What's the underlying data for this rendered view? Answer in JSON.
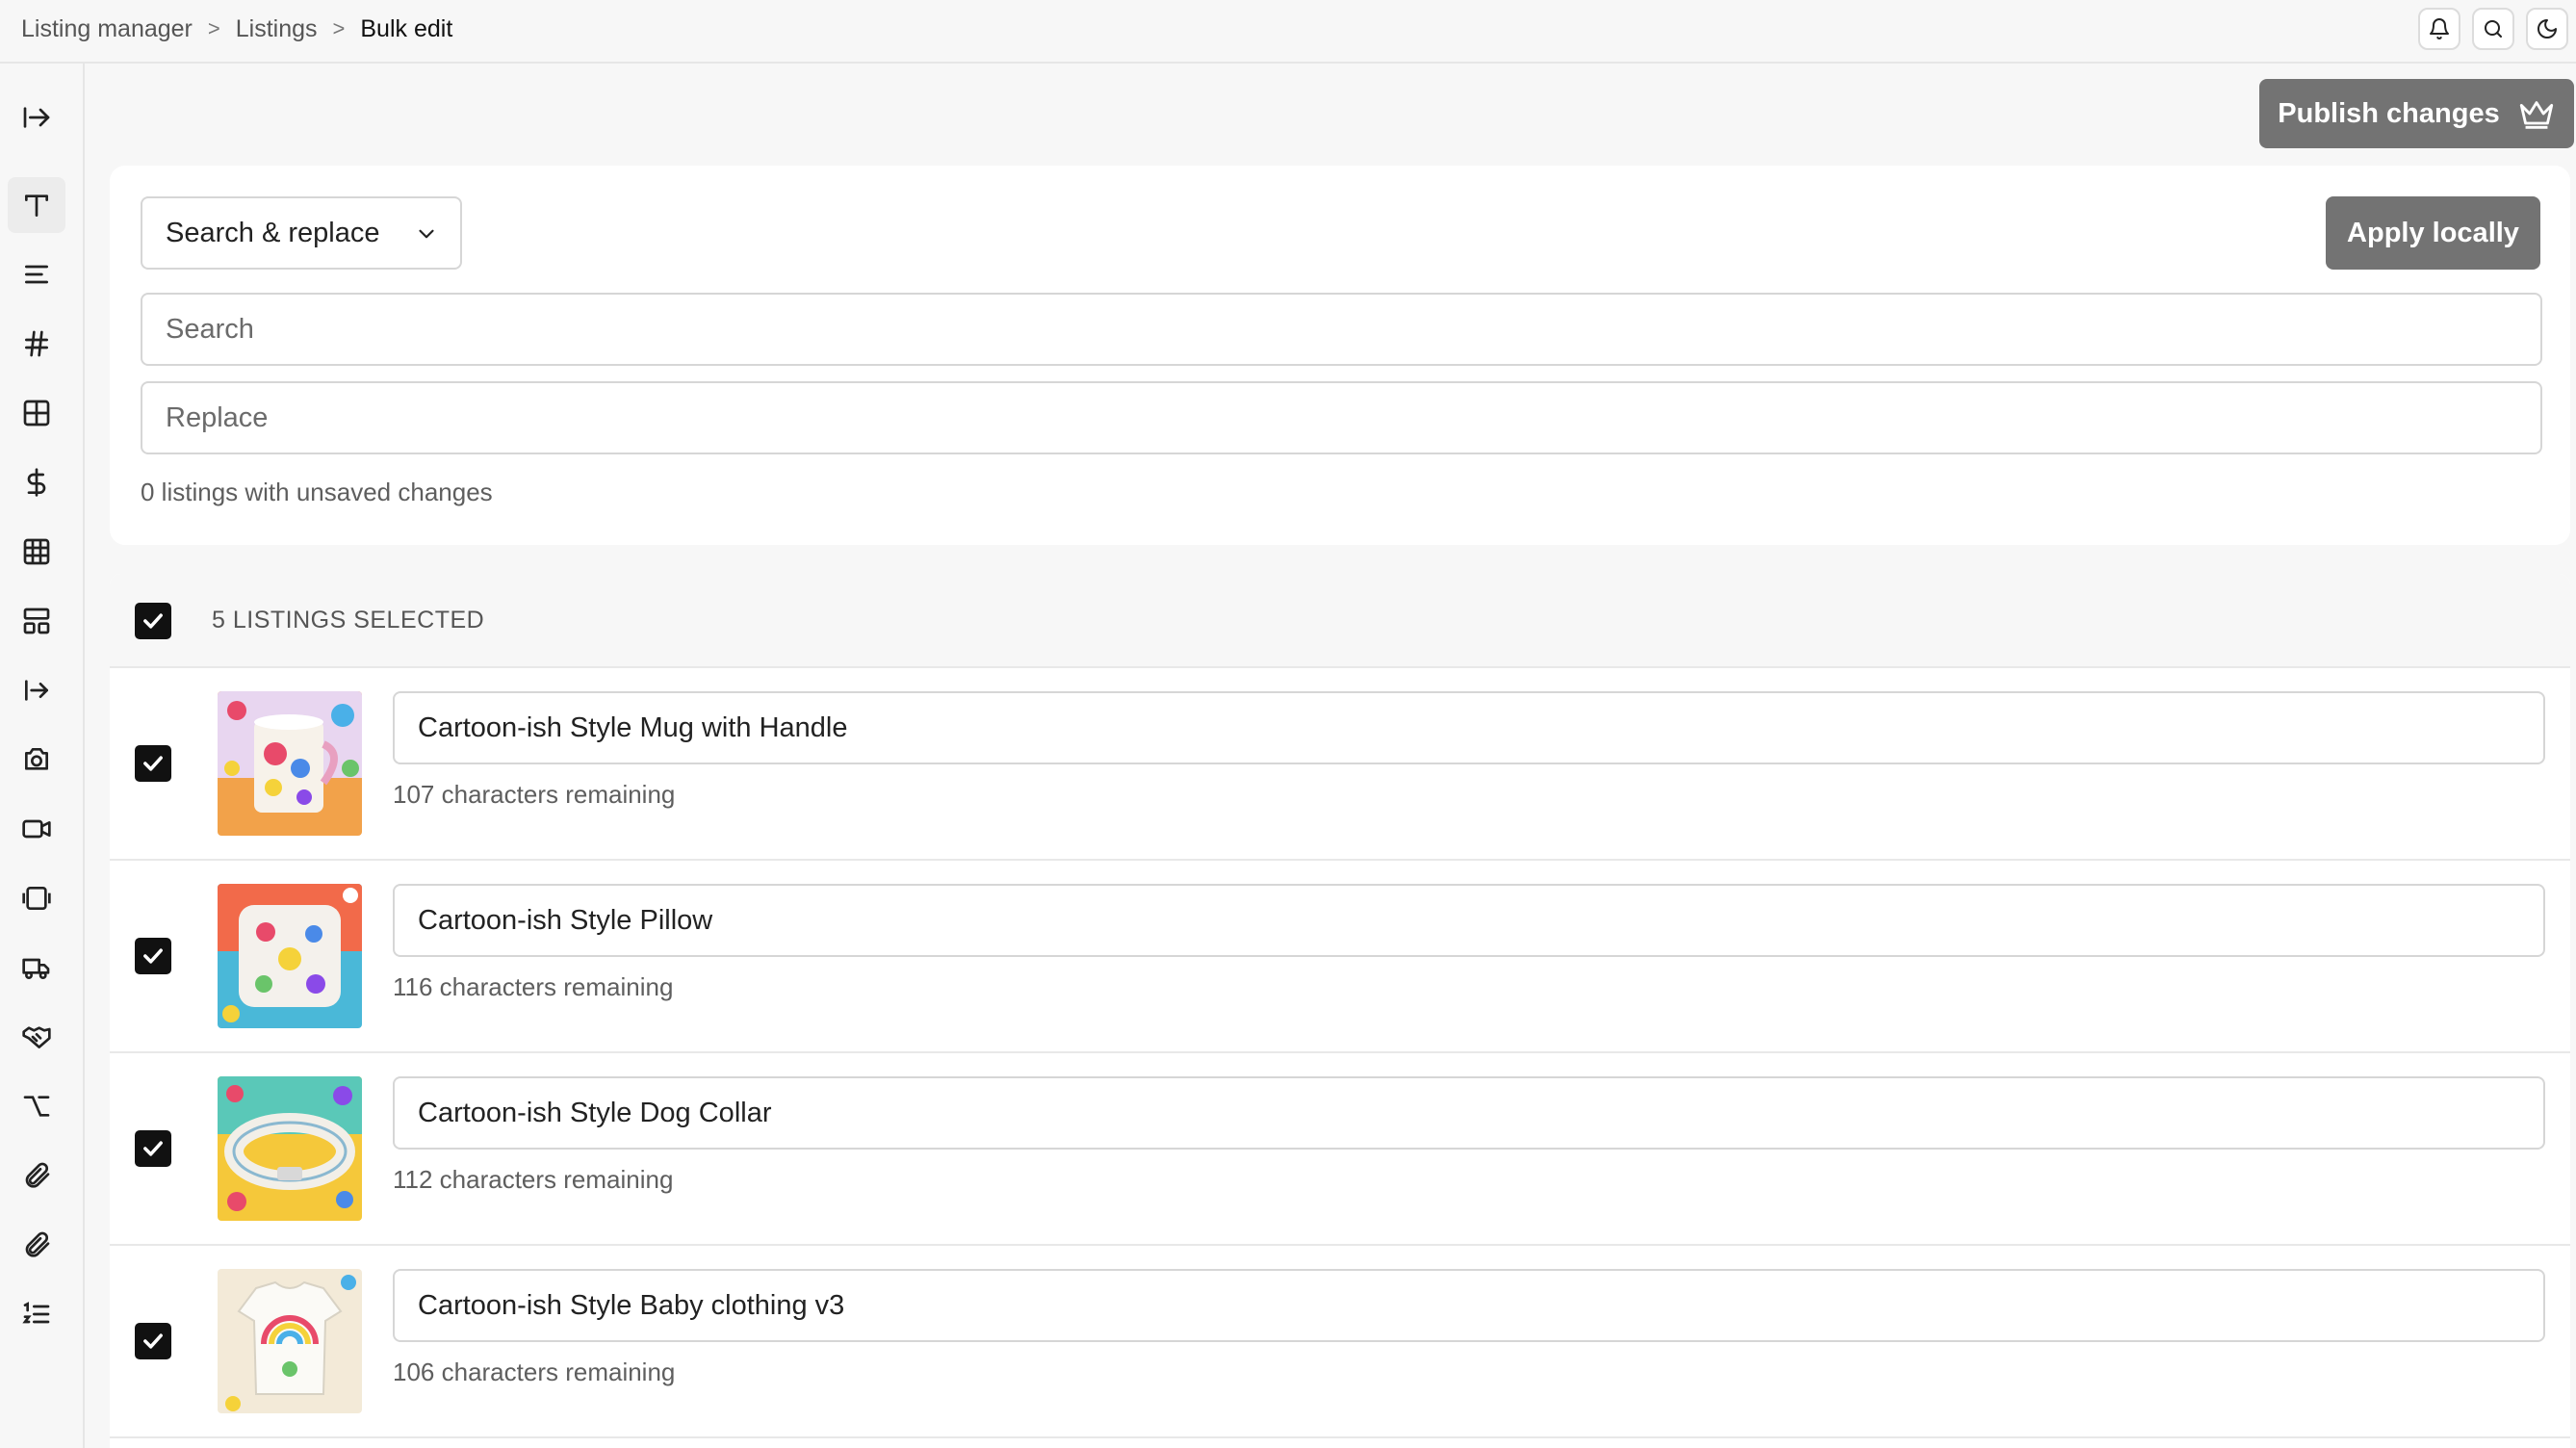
{
  "breadcrumb": {
    "items": [
      "Listing manager",
      "Listings",
      "Bulk edit"
    ],
    "separator": ">"
  },
  "top_icons": [
    "bell-icon",
    "search-icon",
    "moon-icon"
  ],
  "sidebar": {
    "toggle_icon": "sidebar-expand-icon",
    "items": [
      {
        "icon": "type-icon",
        "active": true
      },
      {
        "icon": "text-lines-icon",
        "active": false
      },
      {
        "icon": "hash-icon",
        "active": false
      },
      {
        "icon": "grid-icon",
        "active": false
      },
      {
        "icon": "dollar-icon",
        "active": false
      },
      {
        "icon": "table-icon",
        "active": false
      },
      {
        "icon": "layout-icon",
        "active": false
      },
      {
        "icon": "arrow-right-bar-icon",
        "active": false
      },
      {
        "icon": "camera-icon",
        "active": false
      },
      {
        "icon": "video-icon",
        "active": false
      },
      {
        "icon": "layers-icon",
        "active": false
      },
      {
        "icon": "truck-icon",
        "active": false
      },
      {
        "icon": "handshake-icon",
        "active": false
      },
      {
        "icon": "option-key-icon",
        "active": false
      },
      {
        "icon": "paperclip-icon",
        "active": false
      },
      {
        "icon": "paperclip-icon",
        "active": false
      },
      {
        "icon": "list-ordered-icon",
        "active": false
      }
    ]
  },
  "actions": {
    "publish_label": "Publish changes",
    "publish_icon": "crown-icon",
    "apply_label": "Apply locally"
  },
  "editor": {
    "mode": "Search & replace",
    "search_placeholder": "Search",
    "search_value": "",
    "replace_placeholder": "Replace",
    "replace_value": "",
    "unsaved_text": "0 listings with unsaved changes"
  },
  "listings": {
    "header_label": "5 LISTINGS SELECTED",
    "all_checked": true,
    "items": [
      {
        "title": "Cartoon-ish Style Mug with Handle",
        "remaining": "107 characters remaining",
        "checked": true,
        "image": "mug"
      },
      {
        "title": "Cartoon-ish Style Pillow",
        "remaining": "116 characters remaining",
        "checked": true,
        "image": "pillow"
      },
      {
        "title": "Cartoon-ish Style Dog Collar",
        "remaining": "112 characters remaining",
        "checked": true,
        "image": "collar"
      },
      {
        "title": "Cartoon-ish Style Baby clothing v3",
        "remaining": "106 characters remaining",
        "checked": true,
        "image": "baby-clothing"
      }
    ]
  },
  "colors": {
    "button_bg": "#737373",
    "checkbox_bg": "#111111",
    "page_bg": "#f7f7f7",
    "card_bg": "#ffffff"
  }
}
